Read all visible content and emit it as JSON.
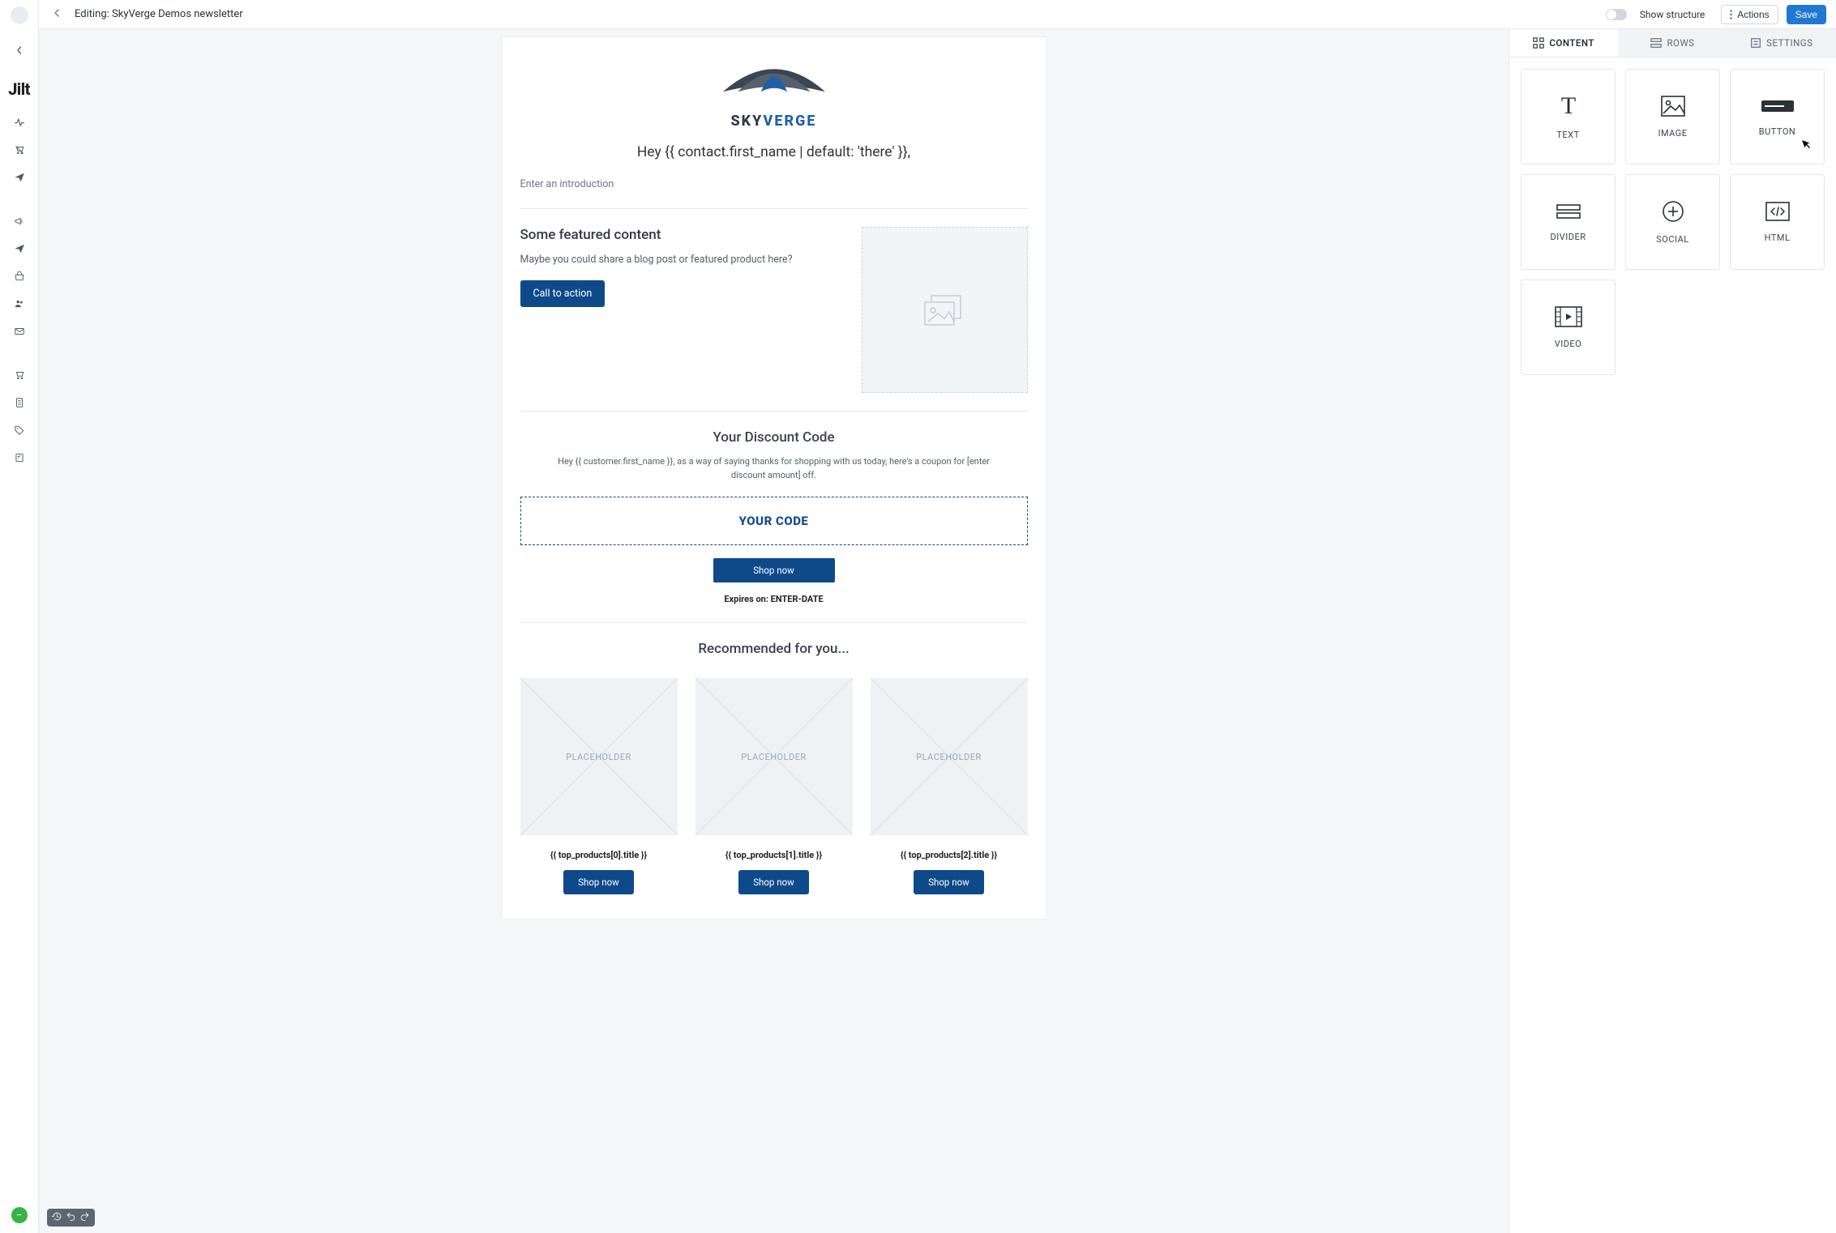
{
  "brand": "Jilt",
  "topbar": {
    "title": "Editing: SkyVerge Demos newsletter",
    "show_structure_label": "Show structure",
    "actions_label": "Actions",
    "save_label": "Save"
  },
  "tabs": {
    "content": "CONTENT",
    "rows": "ROWS",
    "settings": "SETTINGS"
  },
  "blocks": {
    "text": "TEXT",
    "image": "IMAGE",
    "button": "BUTTON",
    "divider": "DIVIDER",
    "social": "SOCIAL",
    "html": "HTML",
    "video": "VIDEO"
  },
  "email": {
    "logo_top": "SKY",
    "logo_bottom": "VERGE",
    "greeting": "Hey {{ contact.first_name | default: 'there' }},",
    "intro_placeholder": "Enter an introduction",
    "feature": {
      "heading": "Some featured content",
      "body": "Maybe you could share a blog post or featured product here?",
      "cta": "Call to action"
    },
    "discount": {
      "heading": "Your Discount Code",
      "body": "Hey {{ customer.first_name }}, as a way of saying thanks for shopping with us today, here's a coupon for [enter discount amount] off.",
      "code": "YOUR CODE",
      "shop_label": "Shop now",
      "expires_label": "Expires on: ENTER-DATE"
    },
    "recommend": {
      "heading": "Recommended for you...",
      "placeholder_label": "PLACEHOLDER",
      "products": [
        {
          "title": "{{ top_products[0].title }}",
          "btn": "Shop now"
        },
        {
          "title": "{{ top_products[1].title }}",
          "btn": "Shop now"
        },
        {
          "title": "{{ top_products[2].title }}",
          "btn": "Shop now"
        }
      ]
    }
  }
}
